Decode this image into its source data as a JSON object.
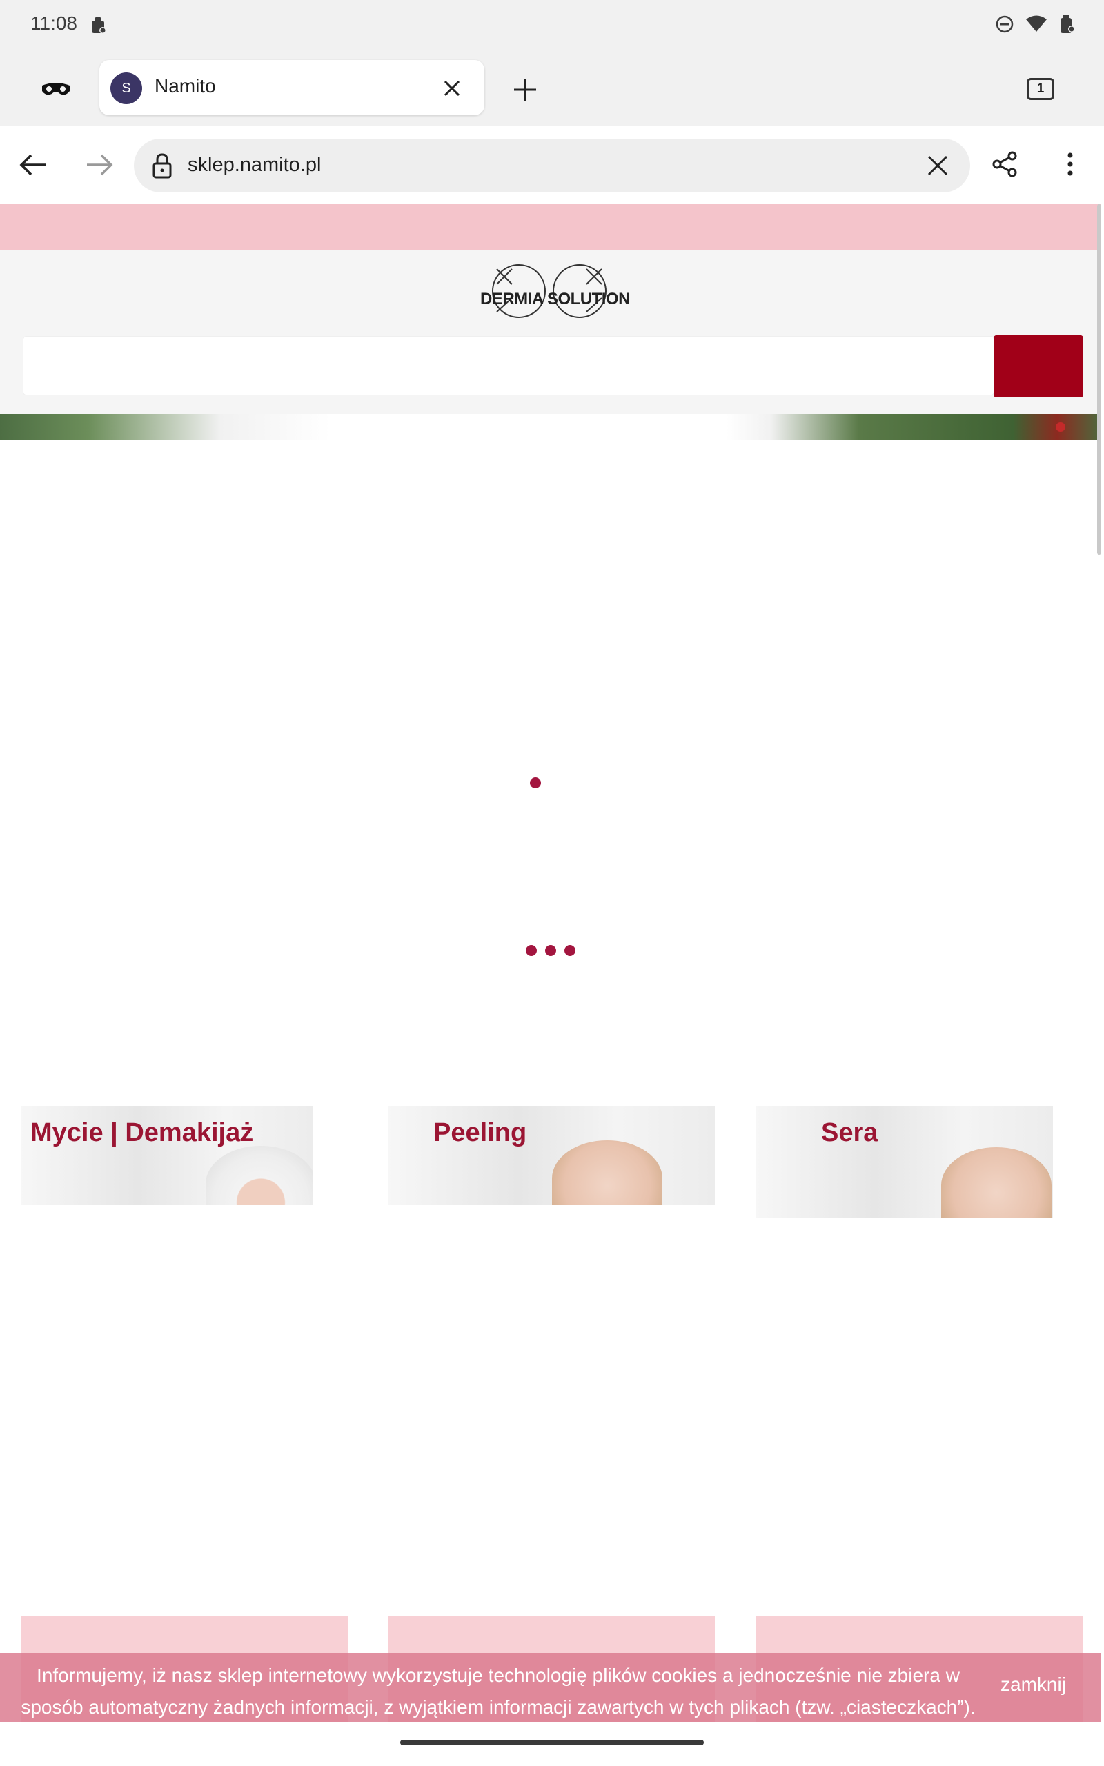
{
  "status_bar": {
    "time": "11:08"
  },
  "browser": {
    "tab": {
      "favicon_letter": "S",
      "title": "Namito"
    },
    "tab_count": "1",
    "url": "sklep.namito.pl"
  },
  "site": {
    "logo_text": "DERMIA SOLUTION",
    "search": {
      "placeholder": ""
    },
    "categories": [
      {
        "label": "Mycie | Demakijaż"
      },
      {
        "label": "Peeling"
      },
      {
        "label": "Sera"
      }
    ],
    "cookie_banner": {
      "text": "Informujemy, iż nasz sklep internetowy wykorzystuje technologię plików cookies a jednocześnie nie zbiera w sposób automatyczny żadnych informacji, z wyjątkiem informacji zawartych w tych plikach (tzw. „ciasteczkach”).",
      "close_label": "zamknij"
    }
  },
  "colors": {
    "accent": "#a10018",
    "promo_strip": "#f4c4cb",
    "category_text": "#9b1533",
    "loader": "#a3153f"
  }
}
